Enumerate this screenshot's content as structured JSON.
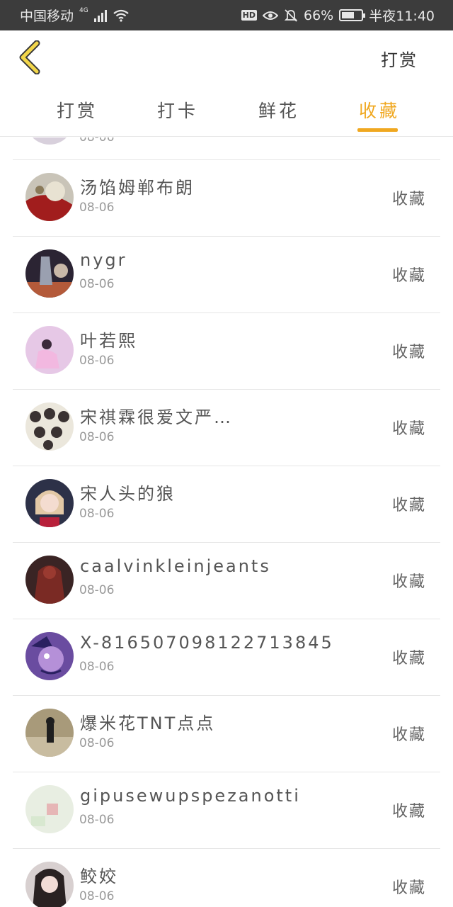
{
  "status_bar": {
    "carrier": "中国移动",
    "network": "4G",
    "hd": "HD",
    "battery_percent": "66%",
    "time": "半夜11:40",
    "battery_level": 0.66
  },
  "header": {
    "back_icon": "chevron-left-icon",
    "action_label": "打赏"
  },
  "tabs": [
    {
      "label": "打赏",
      "active": false
    },
    {
      "label": "打卡",
      "active": false
    },
    {
      "label": "鲜花",
      "active": false
    },
    {
      "label": "收藏",
      "active": true
    }
  ],
  "accent_color": "#f0a820",
  "partial_item": {
    "date": "08-06"
  },
  "items": [
    {
      "name": "汤馅姆郸布朗",
      "date": "08-06",
      "action": "收藏"
    },
    {
      "name": "nygr",
      "date": "08-06",
      "action": "收藏"
    },
    {
      "name": "叶若熙",
      "date": "08-06",
      "action": "收藏"
    },
    {
      "name": "宋祺霖很爱文严…",
      "date": "08-06",
      "action": "收藏"
    },
    {
      "name": "宋人头的狼",
      "date": "08-06",
      "action": "收藏"
    },
    {
      "name": "caalvinkleinjeants",
      "date": "08-06",
      "action": "收藏"
    },
    {
      "name": "X-816507098122713845",
      "date": "08-06",
      "action": "收藏"
    },
    {
      "name": "爆米花TNT点点",
      "date": "08-06",
      "action": "收藏"
    },
    {
      "name": "gipusewupspezanotti",
      "date": "08-06",
      "action": "收藏"
    },
    {
      "name": "鲛姣",
      "date": "08-06",
      "action": "收藏"
    }
  ]
}
